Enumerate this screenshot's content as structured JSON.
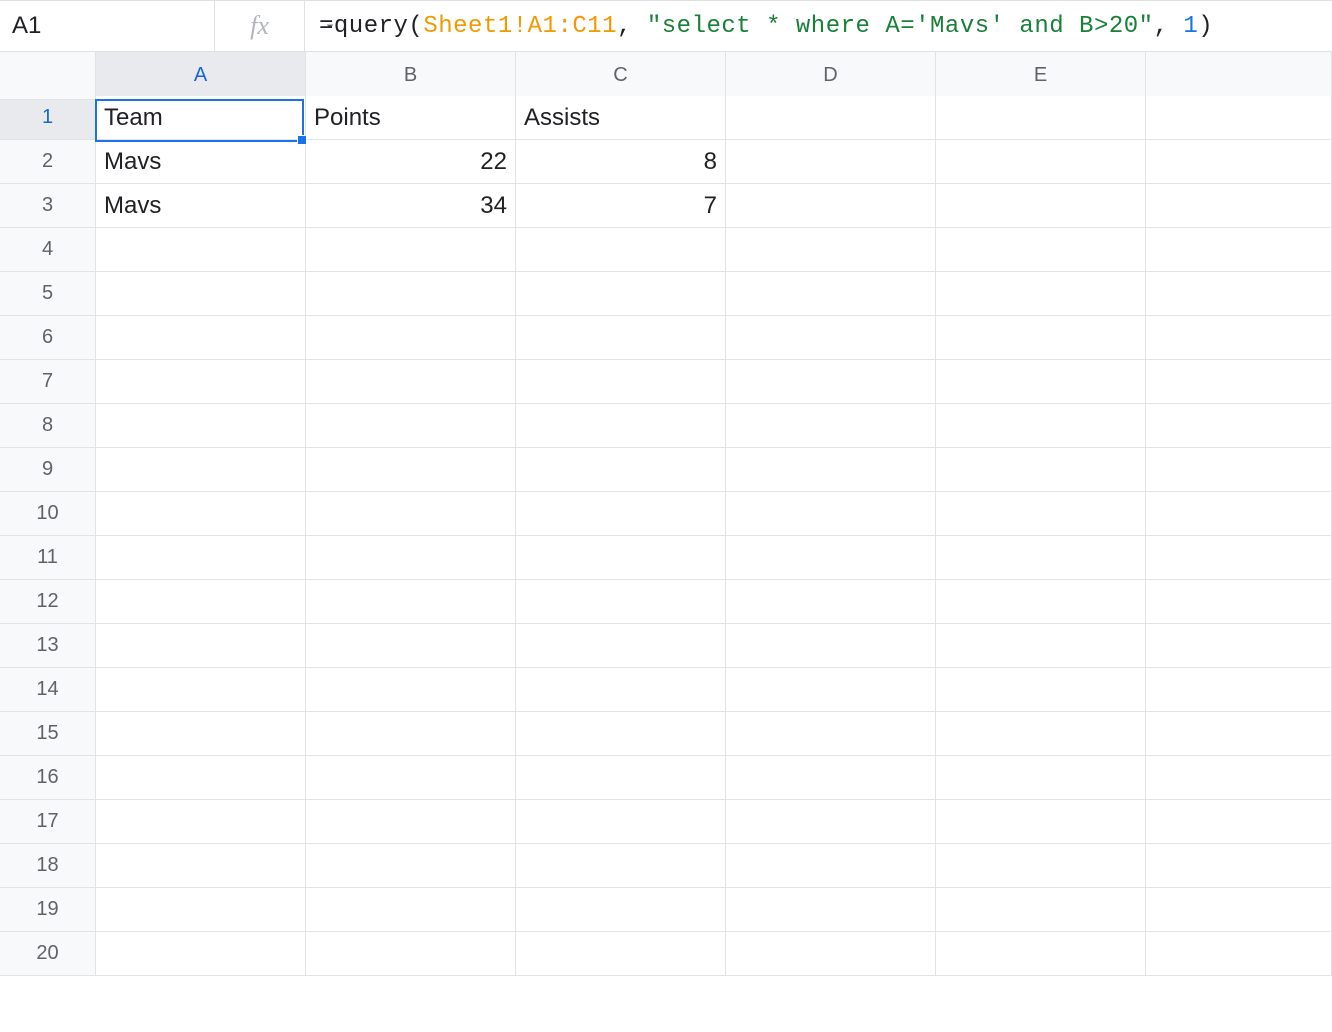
{
  "namebox": {
    "value": "A1"
  },
  "fx_label": "fx",
  "formula": {
    "eq": "=",
    "func": "query",
    "open": "(",
    "range": "Sheet1!A1:C11",
    "comma1": ",",
    "space1": " ",
    "str": "\"select * where A='Mavs' and B>20\"",
    "comma2": ",",
    "space2": " ",
    "num": "1",
    "close": ")"
  },
  "columns": [
    "A",
    "B",
    "C",
    "D",
    "E",
    ""
  ],
  "rows": [
    "1",
    "2",
    "3",
    "4",
    "5",
    "6",
    "7",
    "8",
    "9",
    "10",
    "11",
    "12",
    "13",
    "14",
    "15",
    "16",
    "17",
    "18",
    "19",
    "20"
  ],
  "selected": {
    "row": 0,
    "col": 0
  },
  "grid": [
    [
      {
        "v": "Team",
        "t": "txt"
      },
      {
        "v": "Points",
        "t": "txt"
      },
      {
        "v": "Assists",
        "t": "txt"
      },
      {
        "v": "",
        "t": "txt"
      },
      {
        "v": "",
        "t": "txt"
      },
      {
        "v": "",
        "t": "txt"
      }
    ],
    [
      {
        "v": "Mavs",
        "t": "txt"
      },
      {
        "v": "22",
        "t": "num"
      },
      {
        "v": "8",
        "t": "num"
      },
      {
        "v": "",
        "t": "txt"
      },
      {
        "v": "",
        "t": "txt"
      },
      {
        "v": "",
        "t": "txt"
      }
    ],
    [
      {
        "v": "Mavs",
        "t": "txt"
      },
      {
        "v": "34",
        "t": "num"
      },
      {
        "v": "7",
        "t": "num"
      },
      {
        "v": "",
        "t": "txt"
      },
      {
        "v": "",
        "t": "txt"
      },
      {
        "v": "",
        "t": "txt"
      }
    ],
    [
      {
        "v": "",
        "t": "txt"
      },
      {
        "v": "",
        "t": "txt"
      },
      {
        "v": "",
        "t": "txt"
      },
      {
        "v": "",
        "t": "txt"
      },
      {
        "v": "",
        "t": "txt"
      },
      {
        "v": "",
        "t": "txt"
      }
    ],
    [
      {
        "v": "",
        "t": "txt"
      },
      {
        "v": "",
        "t": "txt"
      },
      {
        "v": "",
        "t": "txt"
      },
      {
        "v": "",
        "t": "txt"
      },
      {
        "v": "",
        "t": "txt"
      },
      {
        "v": "",
        "t": "txt"
      }
    ],
    [
      {
        "v": "",
        "t": "txt"
      },
      {
        "v": "",
        "t": "txt"
      },
      {
        "v": "",
        "t": "txt"
      },
      {
        "v": "",
        "t": "txt"
      },
      {
        "v": "",
        "t": "txt"
      },
      {
        "v": "",
        "t": "txt"
      }
    ],
    [
      {
        "v": "",
        "t": "txt"
      },
      {
        "v": "",
        "t": "txt"
      },
      {
        "v": "",
        "t": "txt"
      },
      {
        "v": "",
        "t": "txt"
      },
      {
        "v": "",
        "t": "txt"
      },
      {
        "v": "",
        "t": "txt"
      }
    ],
    [
      {
        "v": "",
        "t": "txt"
      },
      {
        "v": "",
        "t": "txt"
      },
      {
        "v": "",
        "t": "txt"
      },
      {
        "v": "",
        "t": "txt"
      },
      {
        "v": "",
        "t": "txt"
      },
      {
        "v": "",
        "t": "txt"
      }
    ],
    [
      {
        "v": "",
        "t": "txt"
      },
      {
        "v": "",
        "t": "txt"
      },
      {
        "v": "",
        "t": "txt"
      },
      {
        "v": "",
        "t": "txt"
      },
      {
        "v": "",
        "t": "txt"
      },
      {
        "v": "",
        "t": "txt"
      }
    ],
    [
      {
        "v": "",
        "t": "txt"
      },
      {
        "v": "",
        "t": "txt"
      },
      {
        "v": "",
        "t": "txt"
      },
      {
        "v": "",
        "t": "txt"
      },
      {
        "v": "",
        "t": "txt"
      },
      {
        "v": "",
        "t": "txt"
      }
    ],
    [
      {
        "v": "",
        "t": "txt"
      },
      {
        "v": "",
        "t": "txt"
      },
      {
        "v": "",
        "t": "txt"
      },
      {
        "v": "",
        "t": "txt"
      },
      {
        "v": "",
        "t": "txt"
      },
      {
        "v": "",
        "t": "txt"
      }
    ],
    [
      {
        "v": "",
        "t": "txt"
      },
      {
        "v": "",
        "t": "txt"
      },
      {
        "v": "",
        "t": "txt"
      },
      {
        "v": "",
        "t": "txt"
      },
      {
        "v": "",
        "t": "txt"
      },
      {
        "v": "",
        "t": "txt"
      }
    ],
    [
      {
        "v": "",
        "t": "txt"
      },
      {
        "v": "",
        "t": "txt"
      },
      {
        "v": "",
        "t": "txt"
      },
      {
        "v": "",
        "t": "txt"
      },
      {
        "v": "",
        "t": "txt"
      },
      {
        "v": "",
        "t": "txt"
      }
    ],
    [
      {
        "v": "",
        "t": "txt"
      },
      {
        "v": "",
        "t": "txt"
      },
      {
        "v": "",
        "t": "txt"
      },
      {
        "v": "",
        "t": "txt"
      },
      {
        "v": "",
        "t": "txt"
      },
      {
        "v": "",
        "t": "txt"
      }
    ],
    [
      {
        "v": "",
        "t": "txt"
      },
      {
        "v": "",
        "t": "txt"
      },
      {
        "v": "",
        "t": "txt"
      },
      {
        "v": "",
        "t": "txt"
      },
      {
        "v": "",
        "t": "txt"
      },
      {
        "v": "",
        "t": "txt"
      }
    ],
    [
      {
        "v": "",
        "t": "txt"
      },
      {
        "v": "",
        "t": "txt"
      },
      {
        "v": "",
        "t": "txt"
      },
      {
        "v": "",
        "t": "txt"
      },
      {
        "v": "",
        "t": "txt"
      },
      {
        "v": "",
        "t": "txt"
      }
    ],
    [
      {
        "v": "",
        "t": "txt"
      },
      {
        "v": "",
        "t": "txt"
      },
      {
        "v": "",
        "t": "txt"
      },
      {
        "v": "",
        "t": "txt"
      },
      {
        "v": "",
        "t": "txt"
      },
      {
        "v": "",
        "t": "txt"
      }
    ],
    [
      {
        "v": "",
        "t": "txt"
      },
      {
        "v": "",
        "t": "txt"
      },
      {
        "v": "",
        "t": "txt"
      },
      {
        "v": "",
        "t": "txt"
      },
      {
        "v": "",
        "t": "txt"
      },
      {
        "v": "",
        "t": "txt"
      }
    ],
    [
      {
        "v": "",
        "t": "txt"
      },
      {
        "v": "",
        "t": "txt"
      },
      {
        "v": "",
        "t": "txt"
      },
      {
        "v": "",
        "t": "txt"
      },
      {
        "v": "",
        "t": "txt"
      },
      {
        "v": "",
        "t": "txt"
      }
    ],
    [
      {
        "v": "",
        "t": "txt"
      },
      {
        "v": "",
        "t": "txt"
      },
      {
        "v": "",
        "t": "txt"
      },
      {
        "v": "",
        "t": "txt"
      },
      {
        "v": "",
        "t": "txt"
      },
      {
        "v": "",
        "t": "txt"
      }
    ]
  ]
}
